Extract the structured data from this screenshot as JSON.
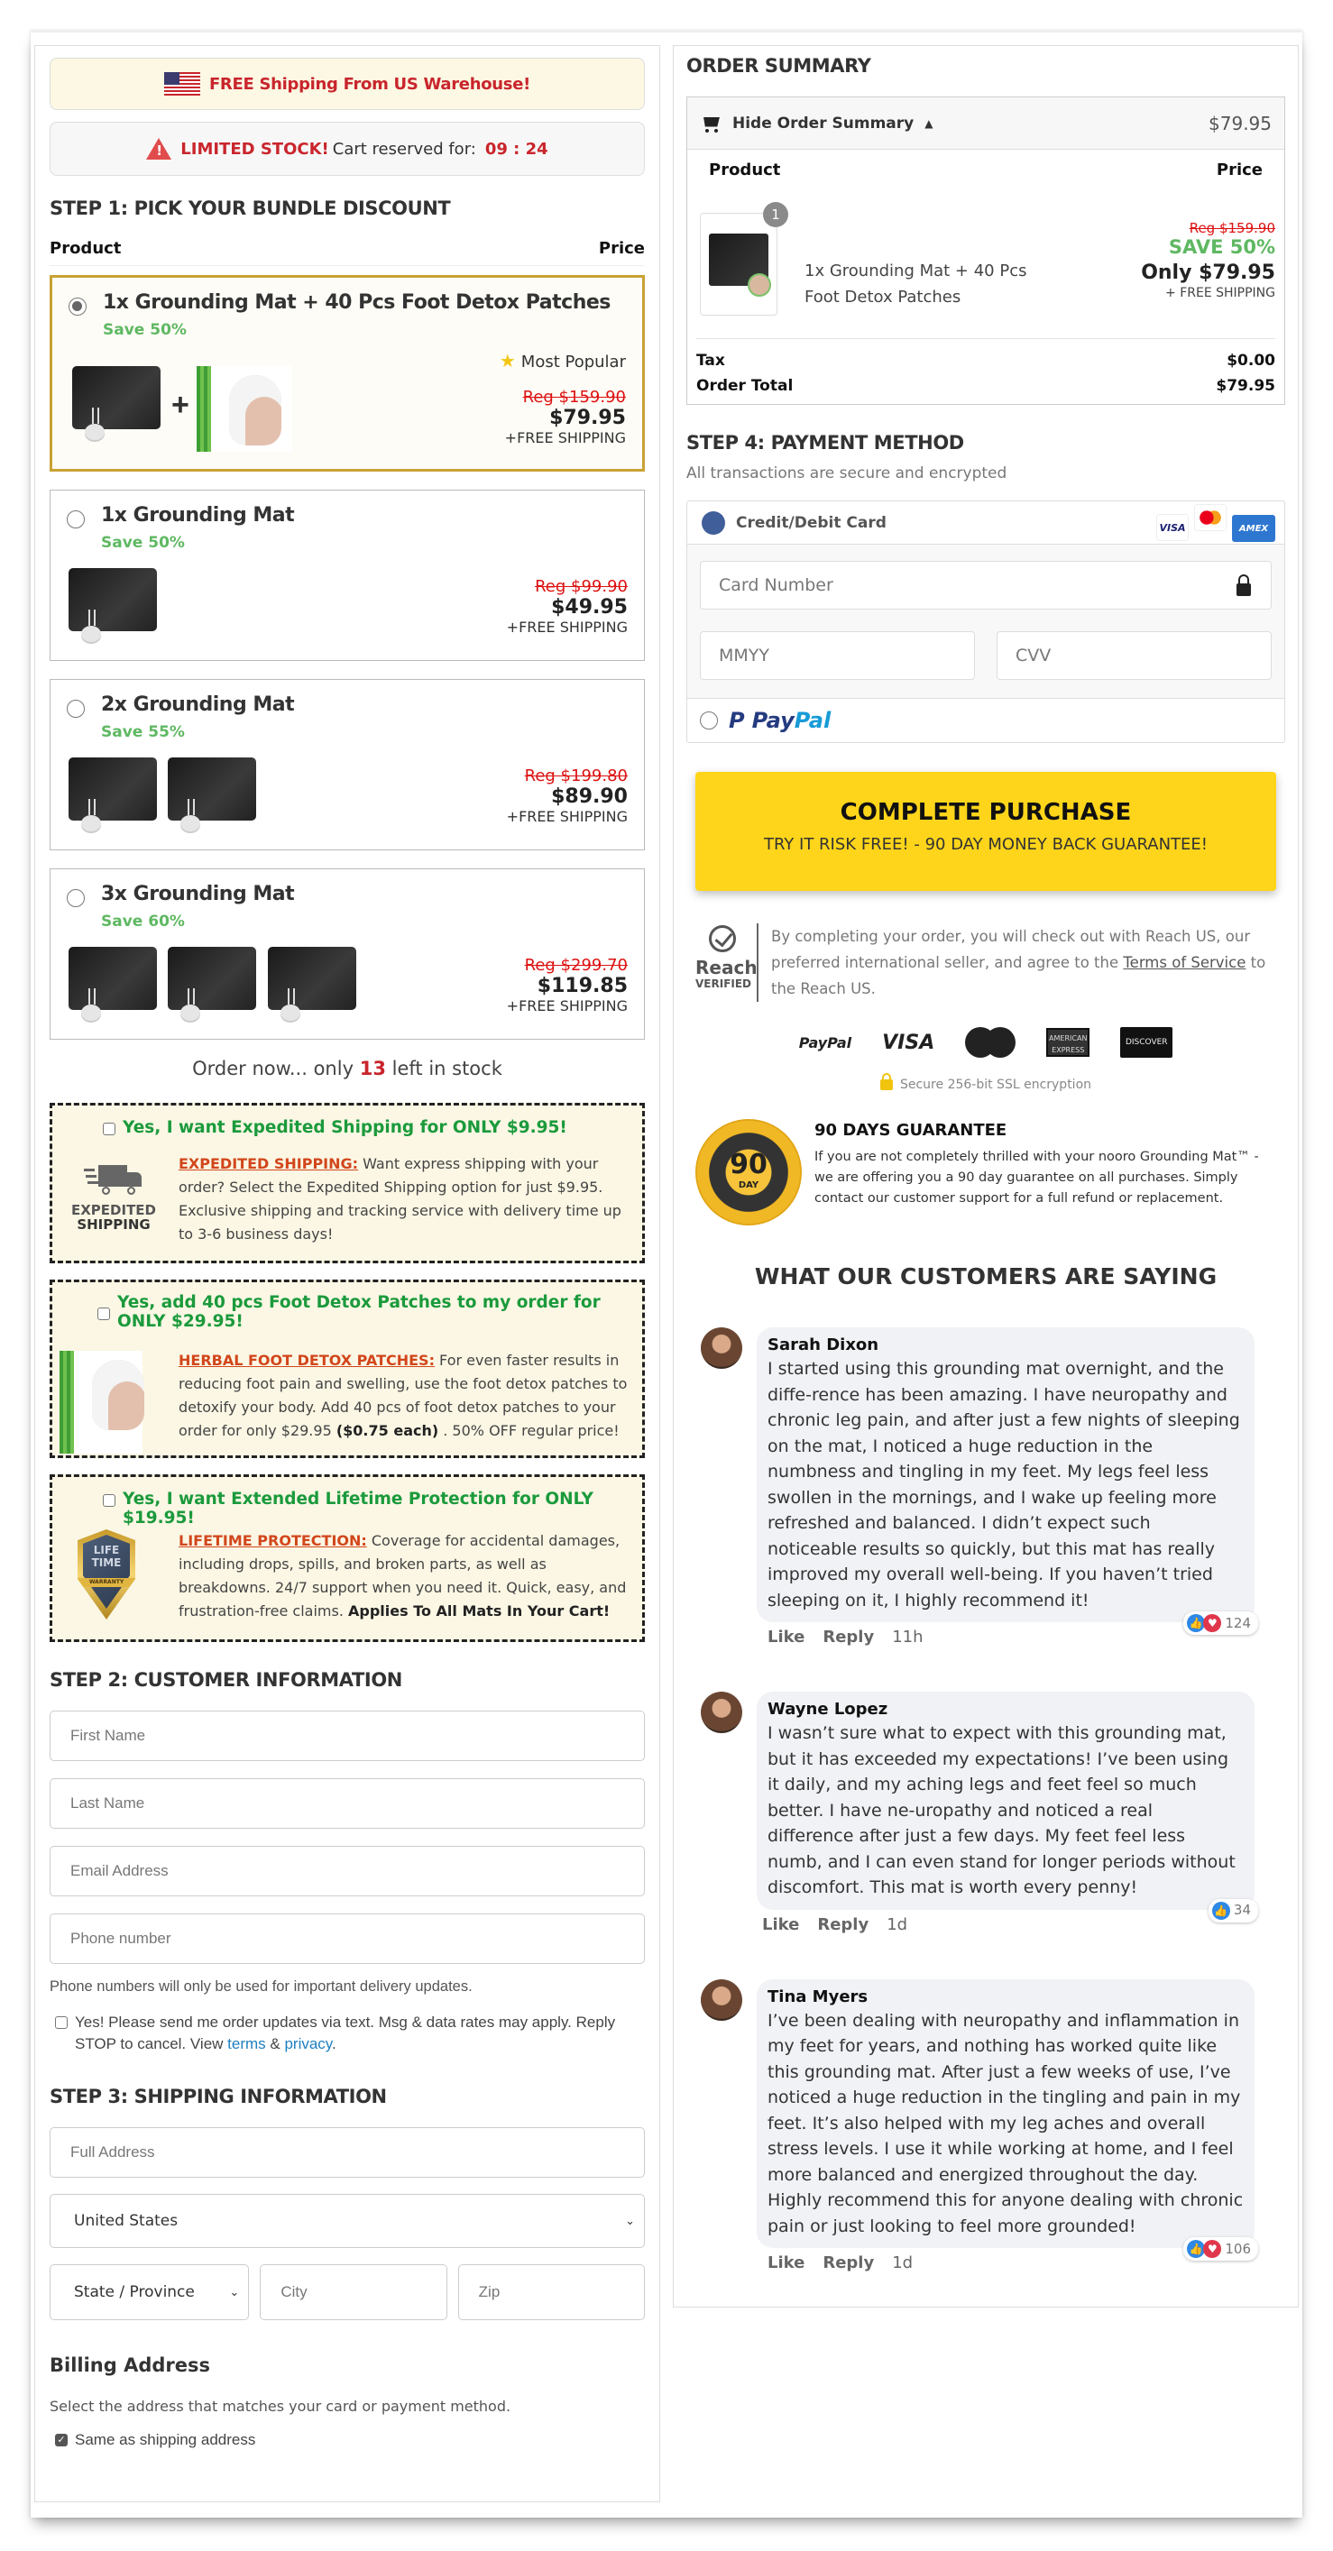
{
  "banners": {
    "free_shipping": "FREE Shipping From US Warehouse!",
    "limited_stock_label": "LIMITED STOCK!",
    "cart_reserved_text": "Cart reserved for:",
    "timer": "09 : 24"
  },
  "step1": {
    "heading": "STEP 1: PICK YOUR BUNDLE DISCOUNT",
    "col_product": "Product",
    "col_price": "Price",
    "bundles": [
      {
        "title": "1x Grounding Mat + 40 Pcs Foot Detox Patches",
        "save": "Save 50%",
        "badge": "Most Popular",
        "reg": "Reg $159.90",
        "price": "$79.95",
        "shipping": "+FREE SHIPPING",
        "selected": true
      },
      {
        "title": "1x Grounding Mat",
        "save": "Save 50%",
        "reg": "Reg $99.90",
        "price": "$49.95",
        "shipping": "+FREE SHIPPING",
        "selected": false
      },
      {
        "title": "2x Grounding Mat",
        "save": "Save 55%",
        "reg": "Reg $199.80",
        "price": "$89.90",
        "shipping": "+FREE SHIPPING",
        "selected": false
      },
      {
        "title": "3x Grounding Mat",
        "save": "Save 60%",
        "reg": "Reg $299.70",
        "price": "$119.85",
        "shipping": "+FREE SHIPPING",
        "selected": false
      }
    ],
    "stock_prefix": "Order now... only",
    "stock_count": "13",
    "stock_suffix": "left in stock"
  },
  "upsells": [
    {
      "heading": "Yes, I want Expedited Shipping for ONLY $9.95!",
      "label": "EXPEDITED SHIPPING:",
      "text": " Want express shipping with your order? Select the Expedited Shipping option for just $9.95. Exclusive shipping and tracking service with delivery time up to 3-6 business days!",
      "icon_line1": "EXPEDITED",
      "icon_line2": "SHIPPING",
      "checked": false
    },
    {
      "heading": "Yes, add 40 pcs Foot Detox Patches to my order for ONLY $29.95!",
      "label": "HERBAL FOOT DETOX PATCHES:",
      "text": "  For even faster results in reducing foot pain and swelling, use the foot detox patches to detoxify your body. Add 40 pcs of foot detox patches to your order for only $29.95 ",
      "bold": "($0.75 each)",
      "text_after": " . 50% OFF regular price!",
      "checked": false
    },
    {
      "heading": "Yes, I want Extended Lifetime Protection for ONLY $19.95!",
      "label": "LIFETIME PROTECTION:",
      "text": " Coverage for accidental damages, including drops, spills, and broken parts, as well as breakdowns. 24/7 support when you need it. Quick, easy, and frustration-free claims. ",
      "bold": "Applies To All Mats In Your Cart!",
      "icon_line1": "LIFE",
      "icon_line2": "TIME",
      "icon_line3": "WARRANTY",
      "checked": false
    }
  ],
  "step2": {
    "heading": "STEP 2: CUSTOMER INFORMATION",
    "first_name_placeholder": "First Name",
    "last_name_placeholder": "Last Name",
    "email_placeholder": "Email Address",
    "phone_placeholder": "Phone number",
    "phone_note": "Phone numbers will only be used for important delivery updates.",
    "sms_text": "Yes! Please send me order updates via text. Msg & data rates may apply. Reply STOP to cancel. View ",
    "terms_link": "terms",
    "amp": " & ",
    "privacy_link": "privacy",
    "period": ".",
    "sms_checked": false
  },
  "step3": {
    "heading": "STEP 3: SHIPPING INFORMATION",
    "address_placeholder": "Full Address",
    "country_value": "United States",
    "state_value": "State / Province",
    "city_placeholder": "City",
    "zip_placeholder": "Zip",
    "billing_heading": "Billing Address",
    "billing_note": "Select the address that matches your card or payment method.",
    "same_as_shipping": "Same as shipping address",
    "same_checked": true
  },
  "order_summary": {
    "heading": "ORDER SUMMARY",
    "toggle_label": "Hide Order Summary",
    "toggle_amount": "$79.95",
    "col_product": "Product",
    "col_price": "Price",
    "item": {
      "qty": "1",
      "name": "1x Grounding Mat + 40 Pcs Foot Detox Patches",
      "reg": "Reg $159.90",
      "save": "SAVE 50%",
      "only": "Only $79.95",
      "shipping": "+ FREE SHIPPING"
    },
    "tax_label": "Tax",
    "tax_value": "$0.00",
    "total_label": "Order Total",
    "total_value": "$79.95"
  },
  "step4": {
    "heading": "STEP 4: PAYMENT METHOD",
    "subtitle": "All transactions are secure and encrypted",
    "card_label": "Credit/Debit Card",
    "card_brands": [
      "VISA",
      "MC",
      "AMEX"
    ],
    "card_number_placeholder": "Card Number",
    "expiry_placeholder": "MMYY",
    "cvv_placeholder": "CVV",
    "paypal_a": "Pay",
    "paypal_b": "Pal"
  },
  "cta": {
    "title": "COMPLETE PURCHASE",
    "subtitle": "TRY IT RISK FREE! - 90 DAY MONEY BACK GUARANTEE!"
  },
  "reach": {
    "logo_1": "Reach",
    "logo_2": "VERIFIED",
    "text_before": "By completing your order, you will check out with Reach US, our preferred international seller, and agree to the ",
    "tos_link": "Terms of Service",
    "text_after": " to the Reach US."
  },
  "payment_logos": [
    "PayPal",
    "VISA",
    "MasterCard",
    "AMERICAN EXPRESS",
    "DISCOVER"
  ],
  "ssl_text": "Secure 256-bit SSL encryption",
  "guarantee": {
    "seal_number": "90",
    "seal_day": "DAY",
    "heading": "90 DAYS GUARANTEE",
    "text": "If you are not completely thrilled with your nooro Grounding Mat™ - we are offering you a 90 day guarantee on all purchases. Simply contact our customer support for a full refund or replacement."
  },
  "reviews_heading": "WHAT OUR CUSTOMERS ARE SAYING",
  "reviews": [
    {
      "name": "Sarah Dixon",
      "text": "I started using this grounding mat overnight, and the diffe-rence has been amazing. I have neuropathy and chronic leg pain, and after just a few nights of sleeping on the mat, I noticed a huge reduction in the numbness and tingling in my feet. My legs feel less swollen in the mornings, and I wake up feeling more refreshed and balanced. I didn’t expect such noticeable results so quickly, but this mat has really improved my overall well-being. If you haven’t tried sleeping on it, I highly recommend it!",
      "reactions": "124",
      "time": "11h",
      "like": "Like",
      "reply": "Reply"
    },
    {
      "name": "Wayne Lopez",
      "text": "I wasn’t sure what to expect with this grounding mat, but it has exceeded my expectations! I’ve been using it daily, and my aching legs and feet feel so much better. I have ne-uropathy and noticed a real difference after just a few days. My feet feel less numb, and I can even stand for longer periods without discomfort. This mat is worth every penny!",
      "reactions": "34",
      "time": "1d",
      "like": "Like",
      "reply": "Reply"
    },
    {
      "name": "Tina Myers",
      "text": "I’ve been dealing with neuropathy and inflammation in my feet for years, and nothing has worked quite like this grounding mat. After just a few weeks of use, I’ve noticed a huge reduction in the tingling and pain in my feet. It’s also helped with my leg aches and overall stress levels. I use it while working at home, and I feel more balanced and energized throughout the day. Highly recommend this for anyone dealing with chronic pain or just looking to feel more grounded!",
      "reactions": "106",
      "time": "1d",
      "like": "Like",
      "reply": "Reply"
    }
  ]
}
